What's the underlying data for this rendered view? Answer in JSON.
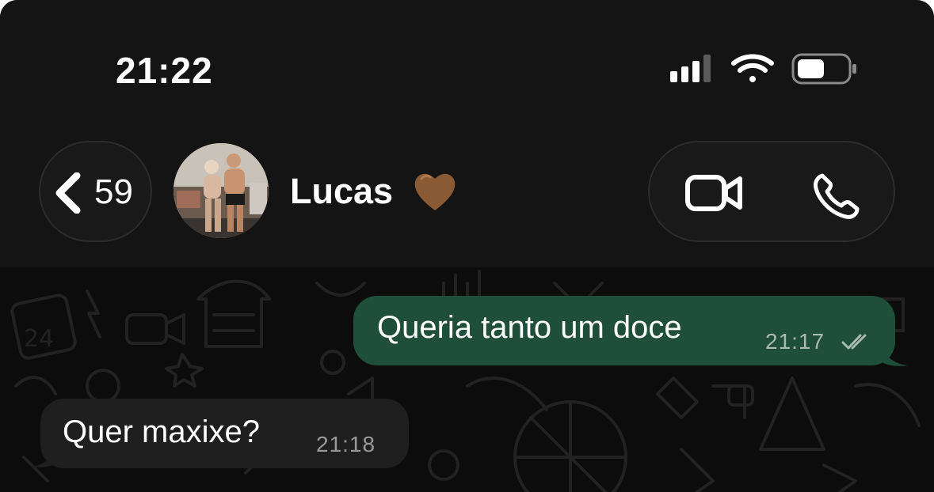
{
  "status_bar": {
    "time": "21:22",
    "icons": [
      "cellular-signal-icon",
      "wifi-icon",
      "battery-icon"
    ],
    "battery_level": 0.45
  },
  "header": {
    "back_count": "59",
    "contact_name": "Lucas",
    "contact_emoji": "🤎",
    "actions": [
      "video-call-icon",
      "phone-call-icon"
    ]
  },
  "messages": [
    {
      "direction": "outgoing",
      "text": "Queria tanto um doce",
      "time": "21:17",
      "status": "read-ticks-icon"
    },
    {
      "direction": "incoming",
      "text": "Quer maxixe?",
      "time": "21:18"
    }
  ],
  "colors": {
    "outgoing_bubble": "#1f4f3a",
    "incoming_bubble": "#1f1f1f",
    "header_bg": "#141414",
    "chat_bg": "#0c0c0c"
  }
}
